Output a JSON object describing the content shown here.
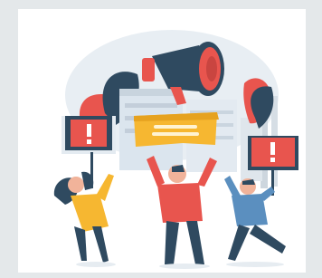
{
  "image": {
    "alt": "",
    "palette": {
      "background": "#e4e8ea",
      "card": "#ffffff",
      "navy": "#2f4a60",
      "red": "#e8554e",
      "yellow": "#f6b731",
      "blue": "#5b8fbf",
      "light_blue": "#dbe5ee",
      "grey": "#cdd6de"
    },
    "icons": [
      "megaphone-icon",
      "exclamation-icon",
      "protest-sign-icon"
    ]
  }
}
